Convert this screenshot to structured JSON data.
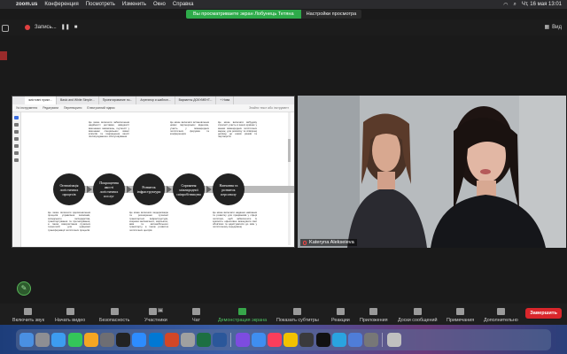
{
  "menubar": {
    "app": "zoom.us",
    "items": [
      "Конференция",
      "Посмотреть",
      "Изменить",
      "Окно",
      "Справка"
    ],
    "clock": "Чт, 16 мая  13:01"
  },
  "share_banner": {
    "status": "Вы просматриваете экран Лобунець Тетяна",
    "options": "Настройки просмотра"
  },
  "zoom_top": {
    "recording": "Запись...",
    "pause": "❚❚",
    "stop": "■",
    "view": "Вид"
  },
  "shared_screen": {
    "tabs": [
      "змістовні прикл...",
      "Basic and White Simple...",
      "Проектирование по...",
      "Агрегатор и шаблон...",
      "Варианты ДОКУМЕНТ...",
      "+ Нова"
    ],
    "toolbar": [
      "Усі інструменти",
      "Редагувати",
      "Перетворити",
      "Електронний підпис"
    ],
    "find_label": "Знайти текст або інструмент",
    "circles": [
      "Оптимізація логістичних процесів",
      "Покращення якості логістичних послуг",
      "Розвиток інфраструктури",
      "Сприяння міжнародної співробітництва",
      "Навчання та розвиток персоналу"
    ],
    "texts_top": [
      "Це може включати забезпечення надійності доставки, швидкості виконання замовлень, гнучкості у виконанні спеціальних вимог клієнтів та покращення якості післяпродажного обслуговування",
      "Це може включати встановлення нових партнерських відносин, участь у міжнародних логістичних форумах та конференціях",
      "Це може включати вибудову стратегії участь в інших країнах у межах міжнародних логістичних мереж, для розвитку та співпраці досвіду до нових ринків та партнерств"
    ],
    "texts_bottom": [
      "Це може включати вдосконалення процесів управління запасами, складського господарства, транспортування та прогнозування, а також використання сучасних технологій для цифрової трансформації логістичних процесів",
      "Це може включати модернізацію та розширення сучасної транспортної інфраструктури, зокрема залізничного, морського, авіа та автомобільного транспорту, а також розвиток логістичних центрів",
      "Це може включати надання навчання та розвитку для працівників у сфері логістики, щоб забезпечити їх здатність ефективно виконувати свої обов'язки та адаптуватися до змін у логістичному середовищі"
    ]
  },
  "video": {
    "participant": "Kateryna Alekseieva"
  },
  "toolbar": {
    "items": [
      {
        "label": "Включить звук",
        "icon": "mic-muted-icon"
      },
      {
        "label": "Начать видео",
        "icon": "video-off-icon"
      },
      {
        "label": "Безопасность",
        "icon": "shield-icon"
      },
      {
        "label": "Участники",
        "icon": "participants-icon",
        "count": "36"
      },
      {
        "label": "Чат",
        "icon": "chat-icon"
      },
      {
        "label": "Демонстрация экрана",
        "icon": "share-screen-icon"
      },
      {
        "label": "Показать субтитры",
        "icon": "captions-icon"
      },
      {
        "label": "Реакции",
        "icon": "reactions-icon"
      },
      {
        "label": "Приложения",
        "icon": "apps-icon"
      },
      {
        "label": "Доски сообщений",
        "icon": "whiteboard-icon"
      },
      {
        "label": "Примечания",
        "icon": "notes-icon"
      },
      {
        "label": "Дополнительно",
        "icon": "more-icon"
      }
    ],
    "end": "Завершить"
  },
  "colors": {
    "banner_green": "#2eab4a",
    "end_red": "#d9262b",
    "share_green": "#37a64a"
  }
}
